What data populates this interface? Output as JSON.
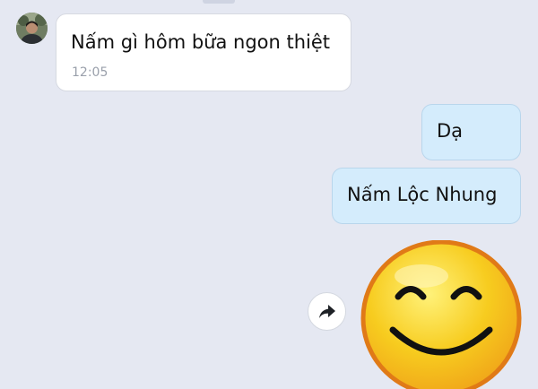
{
  "conversation": {
    "messages": [
      {
        "direction": "incoming",
        "text": "Nấm gì hôm bữa ngon thiệt",
        "time": "12:05"
      },
      {
        "direction": "outgoing",
        "text": "Dạ"
      },
      {
        "direction": "outgoing",
        "text": "Nấm Lộc Nhung"
      },
      {
        "direction": "outgoing",
        "type": "sticker",
        "sticker": "smiling-face-sticker"
      }
    ]
  },
  "icons": {
    "forward": "forward-arrow-icon",
    "avatar": "contact-avatar"
  },
  "colors": {
    "background": "#e5e8f2",
    "incoming_bubble": "#ffffff",
    "outgoing_bubble": "#d4ecfc",
    "sticker_face": "#f7cc1f",
    "sticker_outline": "#e07a17"
  }
}
